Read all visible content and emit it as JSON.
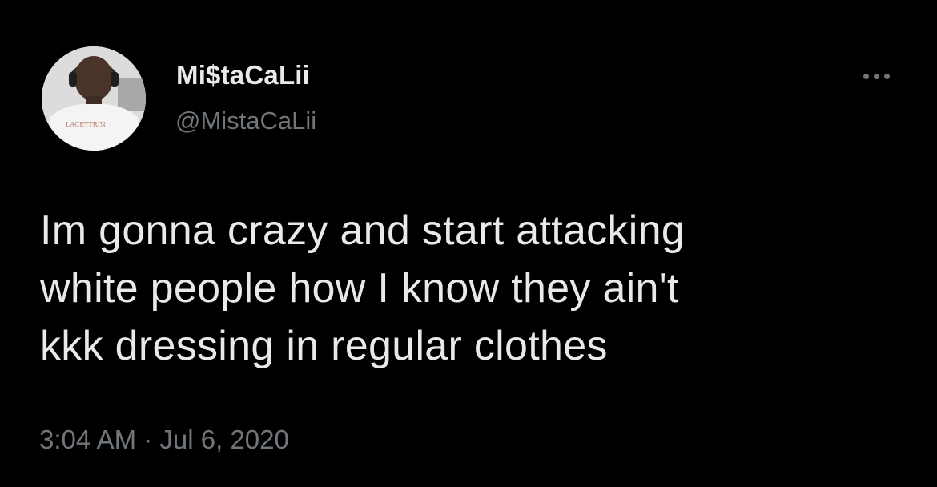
{
  "author": {
    "display_name": "Mi$taCaLii",
    "handle": "@MistaCaLii",
    "avatar_shirt_text": "LACEYTRIN"
  },
  "more_menu_icon": "more-horizontal-icon",
  "tweet": {
    "lines": [
      "Im gonna crazy and start attacking",
      "white people how I know they ain't",
      "kkk dressing in regular clothes"
    ],
    "timestamp": "3:04 AM · Jul 6, 2020"
  },
  "colors": {
    "background": "#000000",
    "primary_text": "#e7e9ea",
    "secondary_text": "#71767b"
  }
}
